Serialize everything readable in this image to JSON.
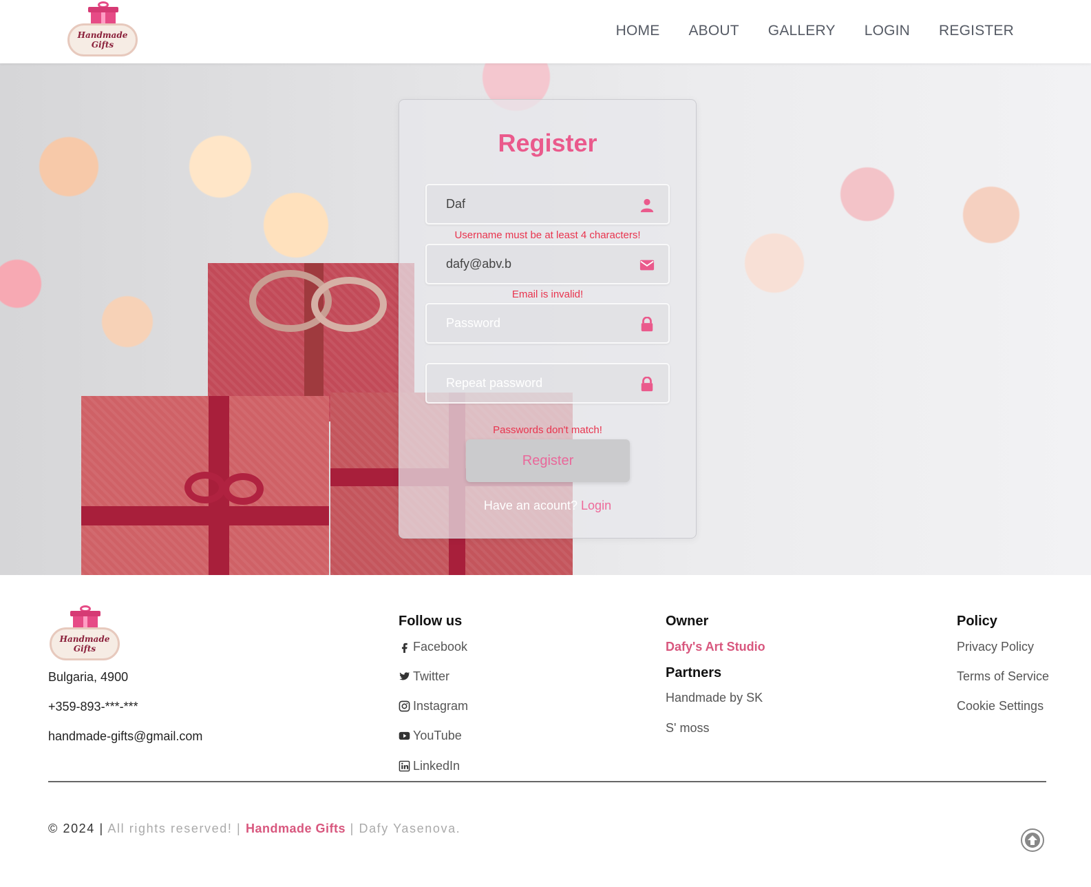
{
  "brand": {
    "logo_line1": "Handmade",
    "logo_line2": "Gifts"
  },
  "nav": {
    "home": "HOME",
    "about": "ABOUT",
    "gallery": "GALLERY",
    "login": "LOGIN",
    "register": "REGISTER"
  },
  "form": {
    "title": "Register",
    "username_value": "Daf",
    "username_error": "Username must be at least 4 characters!",
    "email_value": "dafy@abv.b",
    "email_error": "Email is invalid!",
    "password_placeholder": "Password",
    "repeat_placeholder": "Repeat password",
    "password_error": "Passwords don't match!",
    "submit_label": "Register",
    "have_account": "Have an acount?",
    "login_link": "Login"
  },
  "footer": {
    "address": "Bulgaria, 4900",
    "phone": "+359-893-***-***",
    "email": "handmade-gifts@gmail.com",
    "follow_title": "Follow us",
    "social": [
      "Facebook",
      "Twitter",
      "Instagram",
      "YouTube",
      "LinkedIn"
    ],
    "owner_title": "Owner",
    "owner_name": "Dafy's Art Studio",
    "partners_title": "Partners",
    "partners": [
      "Handmade by SK",
      "S' moss"
    ],
    "policy_title": "Policy",
    "policies": [
      "Privacy Policy",
      "Terms of Service",
      "Cookie Settings"
    ],
    "copyright_prefix": "© 2024 |",
    "rights": "All rights reserved! |",
    "copyright_brand": "Handmade Gifts",
    "author": "| Dafy Yasenova."
  },
  "colors": {
    "accent": "#ea5a8c",
    "error": "#e8344e"
  }
}
